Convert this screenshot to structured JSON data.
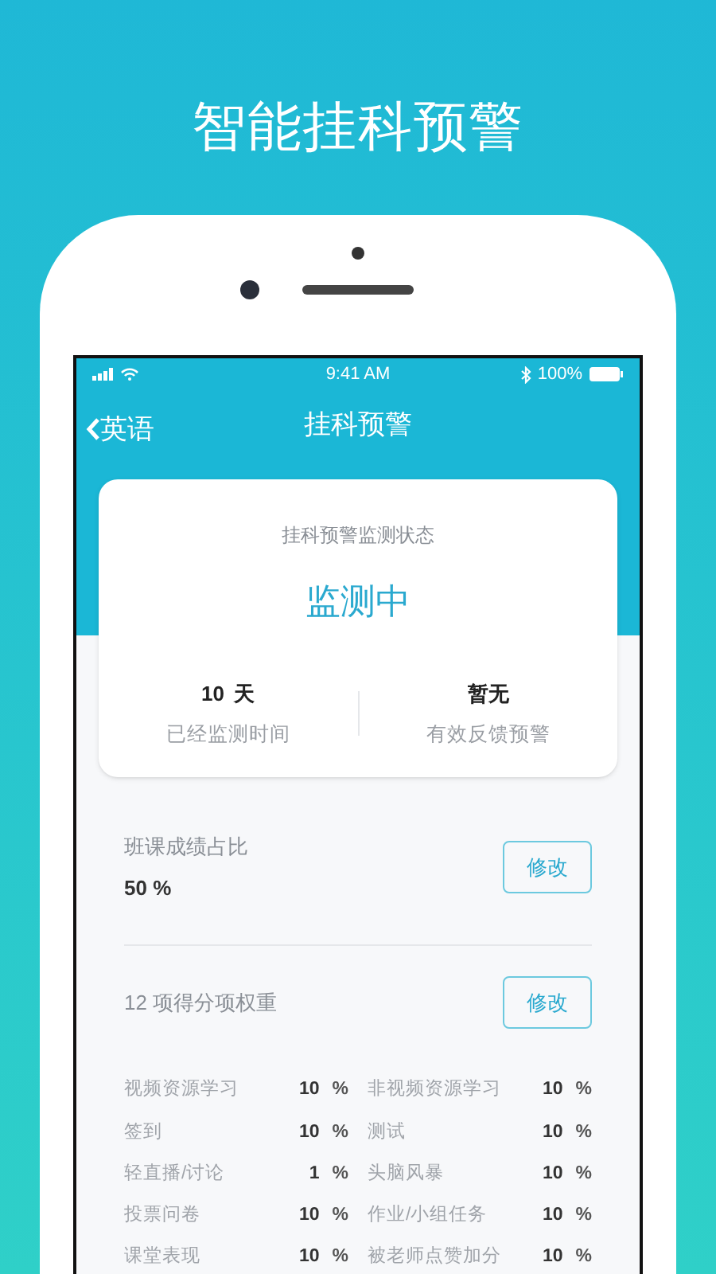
{
  "headline": "智能挂科预警",
  "status_bar": {
    "time": "9:41 AM",
    "battery": "100%"
  },
  "nav": {
    "back": "英语",
    "title": "挂科预警"
  },
  "status_card": {
    "caption": "挂科预警监测状态",
    "status": "监测中",
    "stats": [
      {
        "value": "10",
        "unit": "天",
        "label": "已经监测时间"
      },
      {
        "value": "暂无",
        "label": "有效反馈预警"
      }
    ]
  },
  "score_share": {
    "label": "班课成绩占比",
    "value": "50 %",
    "button": "修改"
  },
  "weights": {
    "label": "12 项得分项权重",
    "button": "修改",
    "items": [
      {
        "name": "视频资源学习",
        "value": "10",
        "unit": "%"
      },
      {
        "name": "非视频资源学习",
        "value": "10",
        "unit": "%"
      },
      {
        "name": "签到",
        "value": "10",
        "unit": "%"
      },
      {
        "name": "测试",
        "value": "10",
        "unit": "%"
      },
      {
        "name": "轻直播/讨论",
        "value": "1",
        "unit": "%"
      },
      {
        "name": "头脑风暴",
        "value": "10",
        "unit": "%"
      },
      {
        "name": "投票问卷",
        "value": "10",
        "unit": "%"
      },
      {
        "name": "作业/小组任务",
        "value": "10",
        "unit": "%"
      },
      {
        "name": "课堂表现",
        "value": "10",
        "unit": "%"
      },
      {
        "name": "被老师点赞加分",
        "value": "10",
        "unit": "%"
      }
    ]
  }
}
